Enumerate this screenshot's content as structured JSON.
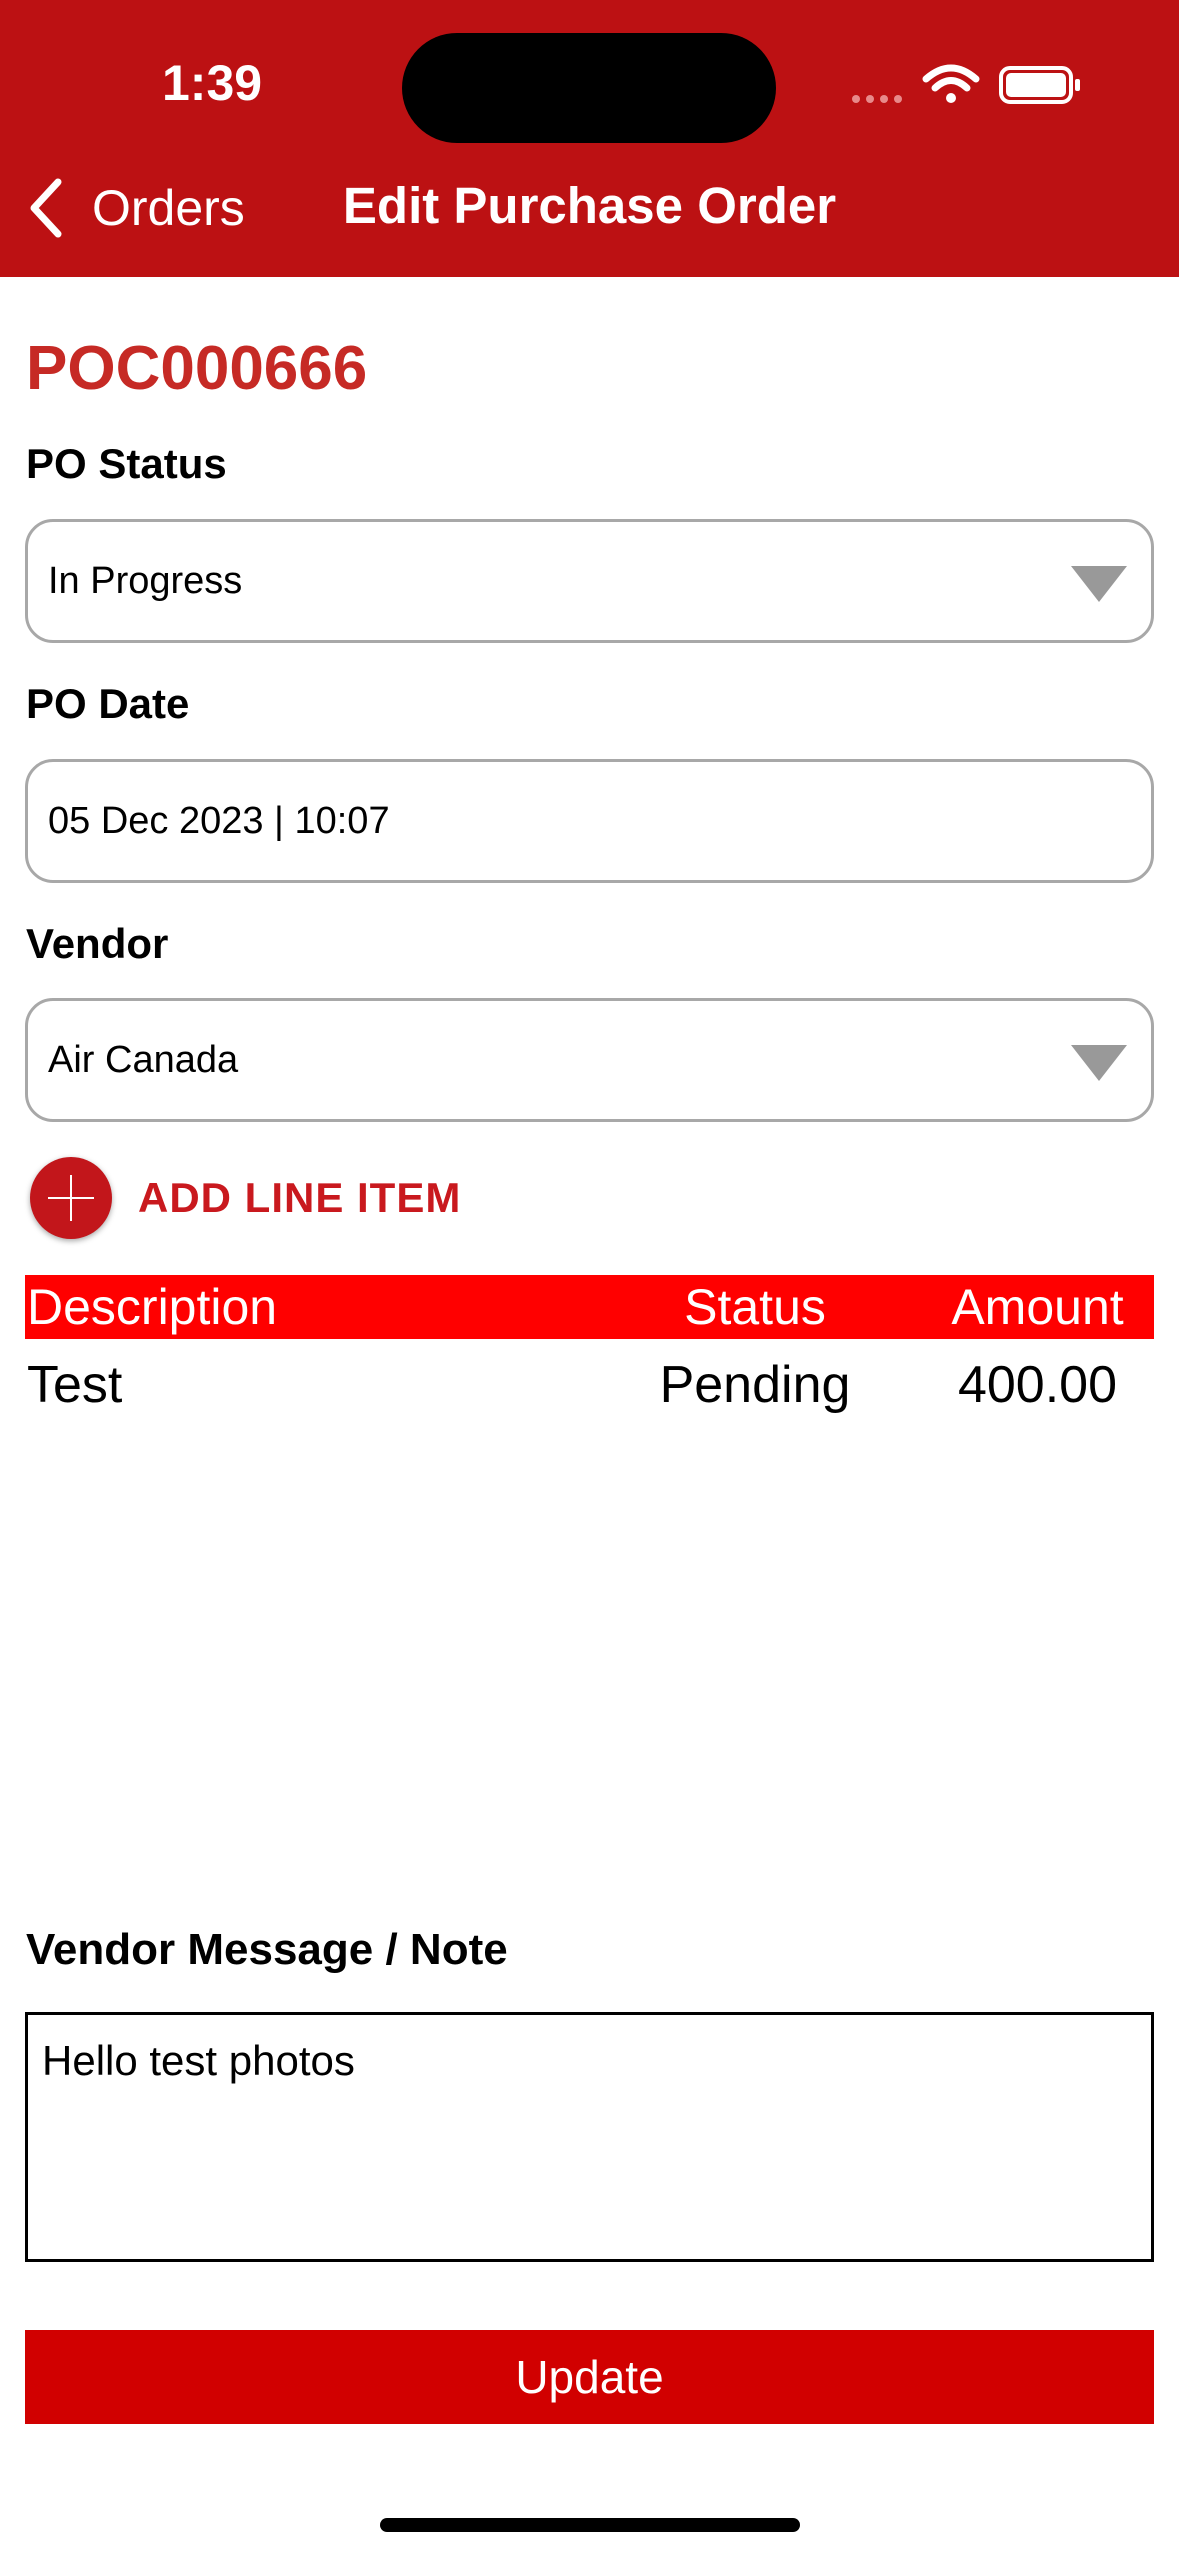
{
  "status_bar": {
    "time": "1:39",
    "icons": [
      "signal-dots-icon",
      "wifi-icon",
      "battery-icon"
    ]
  },
  "nav": {
    "back_label": "Orders",
    "title": "Edit Purchase Order"
  },
  "form": {
    "po_number": "POC000666",
    "po_status": {
      "label": "PO Status",
      "value": "In Progress"
    },
    "po_date": {
      "label": "PO Date",
      "value": "05 Dec 2023 | 10:07"
    },
    "vendor": {
      "label": "Vendor",
      "value": "Air Canada"
    },
    "add_line_item_label": "ADD LINE ITEM"
  },
  "line_items": {
    "headers": [
      "Description",
      "Status",
      "Amount"
    ],
    "rows": [
      {
        "description": "Test",
        "status": "Pending",
        "amount": "400.00"
      }
    ]
  },
  "note": {
    "label": "Vendor Message / Note",
    "value": "Hello test photos"
  },
  "actions": {
    "update_label": "Update"
  },
  "colors": {
    "header_bg": "#bc1113",
    "accent_red": "#c62a25",
    "table_header_bg": "#ff0000",
    "button_bg": "#d10000"
  }
}
